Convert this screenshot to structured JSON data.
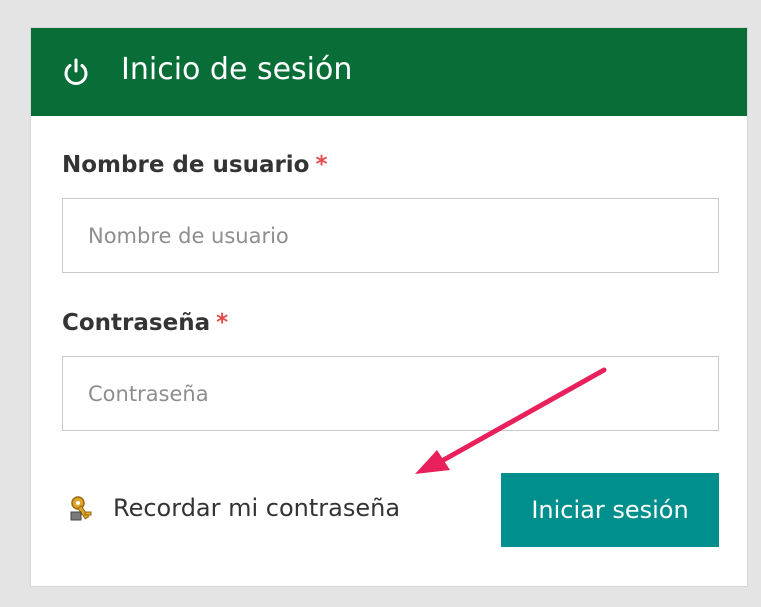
{
  "login": {
    "title": "Inicio de sesión",
    "username": {
      "label": "Nombre de usuario",
      "required_mark": "*",
      "placeholder": "Nombre de usuario",
      "value": ""
    },
    "password": {
      "label": "Contraseña",
      "required_mark": "*",
      "placeholder": "Contraseña",
      "value": ""
    },
    "remember_link": "Recordar mi contraseña",
    "submit_label": "Iniciar sesión"
  },
  "icons": {
    "header": "power-icon",
    "remember": "key-icon"
  },
  "annotation": {
    "type": "arrow",
    "color": "#e8215c"
  },
  "colors": {
    "header_bg": "#086d36",
    "button_bg": "#008f8c",
    "required": "#e24b4b",
    "page_bg": "#e4e4e4"
  }
}
